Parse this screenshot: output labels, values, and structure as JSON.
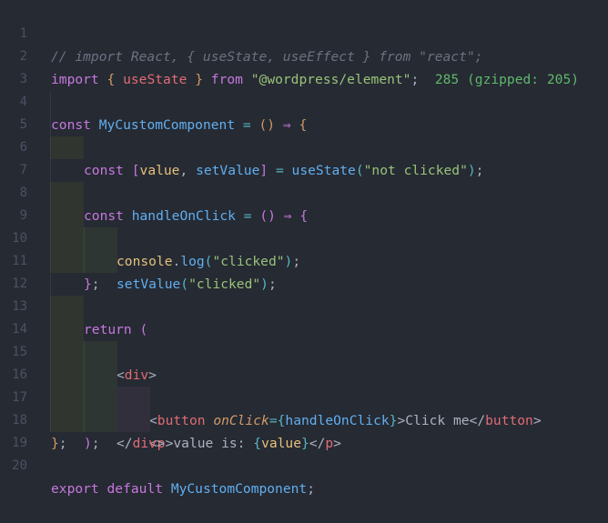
{
  "editor": {
    "line_numbers": [
      "1",
      "2",
      "3",
      "4",
      "5",
      "6",
      "7",
      "8",
      "9",
      "10",
      "11",
      "12",
      "13",
      "14",
      "15",
      "16",
      "17",
      "18",
      "19",
      "20"
    ],
    "colors": {
      "background": "#262a33",
      "keyword": "#c678dd",
      "string": "#98c379",
      "function": "#61afef",
      "variable": "#e06c75",
      "comment": "#6b7280",
      "import_size": "#5fb86b"
    },
    "lines": {
      "l1": {
        "comment": "// import React, { useState, useEffect } from \"react\";"
      },
      "l2": {
        "kw_import": "import",
        "brace_open": "{",
        "name": "useState",
        "brace_close": "}",
        "kw_from": "from",
        "module": "\"@wordpress/element\"",
        "semi": ";",
        "import_cost": "285 (gzipped: 205)"
      },
      "l4": {
        "kw_const": "const",
        "name": "MyCustomComponent",
        "eq": "=",
        "parens": "()",
        "arrow": "⇒",
        "brace": "{"
      },
      "l5": {
        "kw_const": "const",
        "bracket_open": "[",
        "var1": "value",
        "comma": ",",
        "var2": "setValue",
        "bracket_close": "]",
        "eq": "=",
        "fn": "useState",
        "paren_open": "(",
        "str": "\"not clicked\"",
        "paren_close": ")",
        "semi": ";"
      },
      "l7": {
        "kw_const": "const",
        "name": "handleOnClick",
        "eq": "=",
        "parens": "()",
        "arrow": "⇒",
        "brace": "{"
      },
      "l8": {
        "obj": "console",
        "dot": ".",
        "fn": "log",
        "paren_open": "(",
        "str": "\"clicked\"",
        "paren_close": ")",
        "semi": ";"
      },
      "l9": {
        "fn": "setValue",
        "paren_open": "(",
        "str": "\"clicked\"",
        "paren_close": ")",
        "semi": ";"
      },
      "l10": {
        "brace": "}",
        "semi": ";"
      },
      "l12": {
        "kw_return": "return",
        "paren": "("
      },
      "l13": {
        "lt": "<",
        "tag": "div",
        "gt": ">"
      },
      "l14": {
        "lt": "<",
        "tag": "button",
        "attr": "onClick",
        "eq": "=",
        "brace_open": "{",
        "handler": "handleOnClick",
        "brace_close": "}",
        "gt": ">",
        "text": "Click me",
        "close_lt": "</",
        "close_tag": "button",
        "close_gt": ">"
      },
      "l15": {
        "lt": "<",
        "tag": "p",
        "gt": ">",
        "text": "value is: ",
        "brace_open": "{",
        "var": "value",
        "brace_close": "}",
        "close_lt": "</",
        "close_tag": "p",
        "close_gt": ">"
      },
      "l16": {
        "close_lt": "</",
        "tag": "div",
        "gt": ">"
      },
      "l17": {
        "paren": ")",
        "semi": ";"
      },
      "l18": {
        "brace": "}",
        "semi": ";"
      },
      "l20": {
        "kw_export": "export",
        "kw_default": "default",
        "name": "MyCustomComponent",
        "semi": ";"
      }
    }
  }
}
